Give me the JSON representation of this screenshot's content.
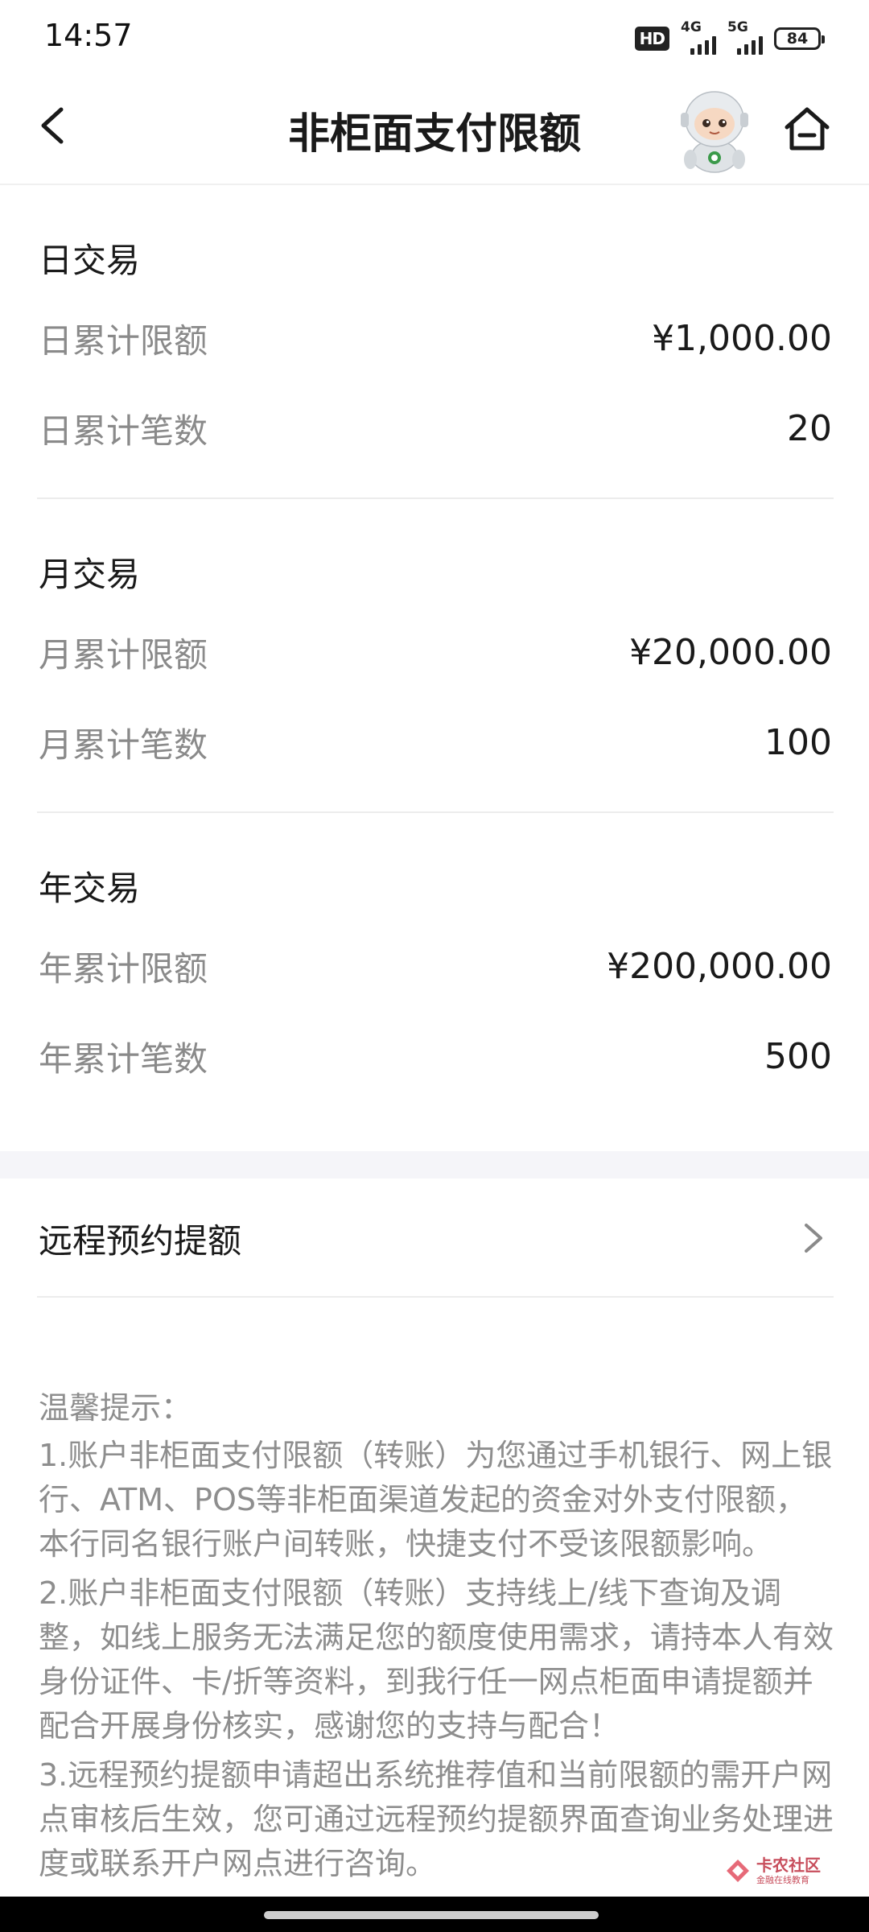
{
  "status_bar": {
    "time": "14:57",
    "hd_label": "HD",
    "network_1": "4G",
    "network_2": "5G",
    "battery": "84"
  },
  "header": {
    "title": "非柜面支付限额",
    "back_icon": "chevron-left-icon",
    "mascot_icon": "robot-mascot-icon",
    "home_icon": "home-icon"
  },
  "sections": [
    {
      "title": "日交易",
      "rows": [
        {
          "label": "日累计限额",
          "value": "¥1,000.00"
        },
        {
          "label": "日累计笔数",
          "value": "20"
        }
      ]
    },
    {
      "title": "月交易",
      "rows": [
        {
          "label": "月累计限额",
          "value": "¥20,000.00"
        },
        {
          "label": "月累计笔数",
          "value": "100"
        }
      ]
    },
    {
      "title": "年交易",
      "rows": [
        {
          "label": "年累计限额",
          "value": "¥200,000.00"
        },
        {
          "label": "年累计笔数",
          "value": "500"
        }
      ]
    }
  ],
  "remote": {
    "label": "远程预约提额"
  },
  "tips": {
    "title": "温馨提示：",
    "items": [
      "1.账户非柜面支付限额（转账）为您通过手机银行、网上银行、ATM、POS等非柜面渠道发起的资金对外支付限额，本行同名银行账户间转账，快捷支付不受该限额影响。",
      "2.账户非柜面支付限额（转账）支持线上/线下查询及调整，如线上服务无法满足您的额度使用需求，请持本人有效身份证件、卡/折等资料，到我行任一网点柜面申请提额并配合开展身份核实，感谢您的支持与配合！",
      "3.远程预约提额申请超出系统推荐值和当前限额的需开户网点审核后生效，您可通过远程预约提额界面查询业务处理进度或联系开户网点进行咨询。"
    ]
  },
  "watermark": {
    "main": "卡农社区",
    "sub": "金融在线教育"
  },
  "colors": {
    "label_gray": "#8a8a8a",
    "text_dark": "#1a1a1a",
    "band_gray": "#f5f5f9",
    "watermark_red": "#c23a4a"
  }
}
